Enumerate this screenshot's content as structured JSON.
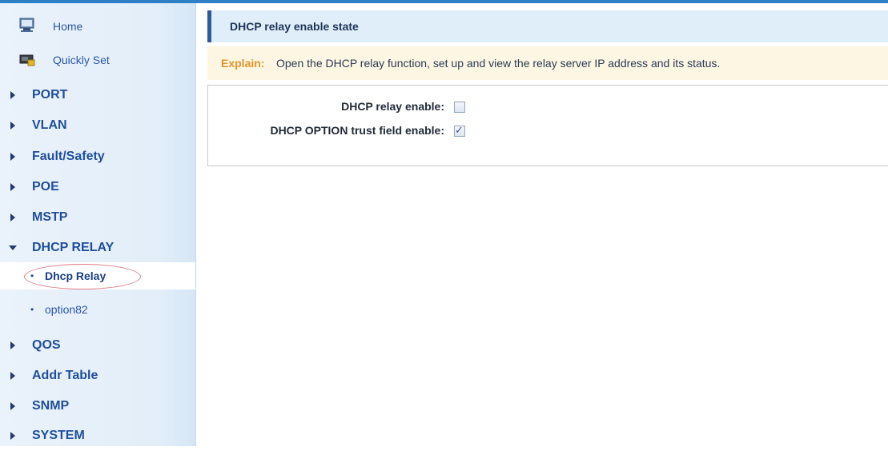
{
  "sidebar": {
    "top_items": [
      {
        "label": "Home",
        "icon": "home-icon"
      },
      {
        "label": "Quickly Set",
        "icon": "quick-set-icon"
      }
    ],
    "menu": [
      {
        "label": "PORT",
        "expanded": false
      },
      {
        "label": "VLAN",
        "expanded": false
      },
      {
        "label": "Fault/Safety",
        "expanded": false
      },
      {
        "label": "POE",
        "expanded": false
      },
      {
        "label": "MSTP",
        "expanded": false
      },
      {
        "label": "DHCP RELAY",
        "expanded": true
      },
      {
        "label": "QOS",
        "expanded": false
      },
      {
        "label": "Addr Table",
        "expanded": false
      },
      {
        "label": "SNMP",
        "expanded": false
      },
      {
        "label": "SYSTEM",
        "expanded": false
      }
    ],
    "sub_items": [
      {
        "label": "Dhcp Relay",
        "active": true
      },
      {
        "label": "option82",
        "active": false
      }
    ],
    "bullet": "•"
  },
  "main": {
    "title": "DHCP relay enable state",
    "explain_label": "Explain:",
    "explain_text": "Open the DHCP relay function, set up and view the relay server IP address and its status.",
    "fields": [
      {
        "label": "DHCP relay enable:",
        "checked": false
      },
      {
        "label": "DHCP OPTION trust field enable:",
        "checked": true
      }
    ],
    "check_glyph": "✓"
  },
  "colors": {
    "accent": "#2d7fc6",
    "header_bar": "#2e5b96",
    "explain_label": "#e39429",
    "highlight": "#e27b86"
  }
}
